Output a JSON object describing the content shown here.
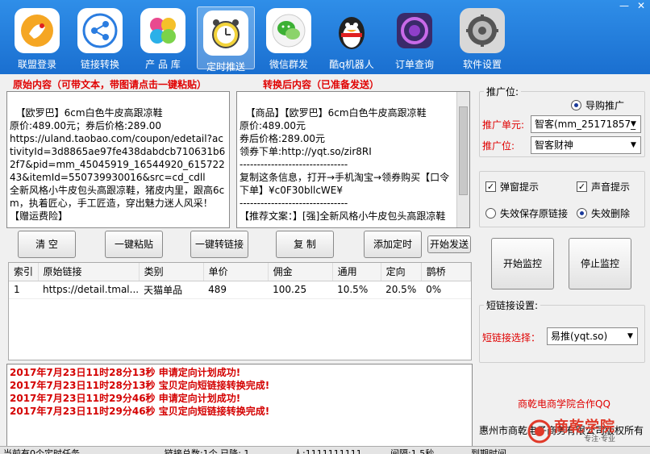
{
  "toolbar": {
    "items": [
      {
        "label": "联盟登录",
        "icon": "kangaroo-logo-icon",
        "color": "#f5a623"
      },
      {
        "label": "链接转换",
        "icon": "share-nodes-icon",
        "color": "#2b7de0"
      },
      {
        "label": "产 品 库",
        "icon": "color-balls-icon",
        "color": "#e94a8f"
      },
      {
        "label": "定时推送",
        "icon": "alarm-clock-icon",
        "color": "#f2d33a"
      },
      {
        "label": "微信群发",
        "icon": "wechat-icon",
        "color": "#3cb034"
      },
      {
        "label": "酷q机器人",
        "icon": "penguin-icon",
        "color": "#e02020"
      },
      {
        "label": "订单查询",
        "icon": "order-lens-icon",
        "color": "#8e3fc9"
      },
      {
        "label": "软件设置",
        "icon": "gear-icon",
        "color": "#666666"
      }
    ]
  },
  "source": {
    "title": "原始内容（可带文本，带图请点击一键粘贴）",
    "text": "【欧罗巴】6cm白色牛皮高跟凉鞋\n原价:489.00元；券后价格:289.00\nhttps://uland.taobao.com/coupon/edetail?activityId=3d8865ae97fe438dabdcb710631b62f7&pid=mm_45045919_16544920_61572243&itemId=550739930016&src=cd_cdll\n全新风格小牛皮包头高跟凉鞋，猪皮内里，跟高6cm，执着匠心，手工匠造，穿出魅力迷人风采！\n【赠运费险】"
  },
  "converted": {
    "title": "转换后内容（已准备发送）",
    "text": "【商品】【欧罗巴】6cm白色牛皮高跟凉鞋\n原价:489.00元\n券后价格:289.00元\n领券下单:http://yqt.so/zir8RI\n-------------------------------\n复制这条信息，打开→手机淘宝→领券购买【口令下单】¥c0F30bllcWE¥\n-------------------------------\n【推荐文案：】[强]全新风格小牛皮包头高跟凉鞋"
  },
  "buttons": {
    "clear": "清 空",
    "paste": "一键粘贴",
    "convert": "一键转链接",
    "copy": "复 制",
    "add_timer": "添加定时",
    "start_send": "开始发送",
    "start_monitor": "开始监控",
    "stop_monitor": "停止监控"
  },
  "table": {
    "headers": [
      "索引",
      "原始链接",
      "类别",
      "单价",
      "佣金",
      "通用",
      "定向",
      "鹊桥"
    ],
    "rows": [
      [
        "1",
        "https://detail.tmal...",
        "天猫单品",
        "489",
        "100.25",
        "10.5%",
        "20.5%",
        "0%"
      ]
    ]
  },
  "log": [
    "2017年7月23日11时28分13秒  申请定向计划成功!",
    "2017年7月23日11时28分13秒  宝贝定向短链接转换完成!",
    "2017年7月23日11时29分46秒  申请定向计划成功!",
    "2017年7月23日11时29分46秒  宝贝定向短链接转换完成!"
  ],
  "promo": {
    "group_title": "推广位:",
    "radio_label": "导购推广",
    "unit_label": "推广单元:",
    "unit_value": "智客(mm_25171857_",
    "slot_label": "推广位:",
    "slot_value": "智客财神",
    "popup_label": "弹窗提示",
    "sound_label": "声音提示",
    "keep_label": "失效保存原链接",
    "delete_label": "失效删除"
  },
  "shortlink": {
    "group_title": "短链接设置:",
    "select_label": "短链接选择：",
    "select_value": "易推(yqt.so)"
  },
  "footer": {
    "qq_link": "商乾电商学院合作QQ",
    "company": "惠州市商乾电子商务有限公司版权所有",
    "brand": "商乾学院",
    "slogan": "专注·专业"
  },
  "status": {
    "cells": [
      "当前有0个定时任务",
      "链接总数:1个 已降: 1",
      "人:1111111111",
      "间隔:1.5秒",
      "到期时间"
    ]
  },
  "colors": {
    "accent_red": "#e00000",
    "toolbar_blue": "#1f7ad8"
  }
}
